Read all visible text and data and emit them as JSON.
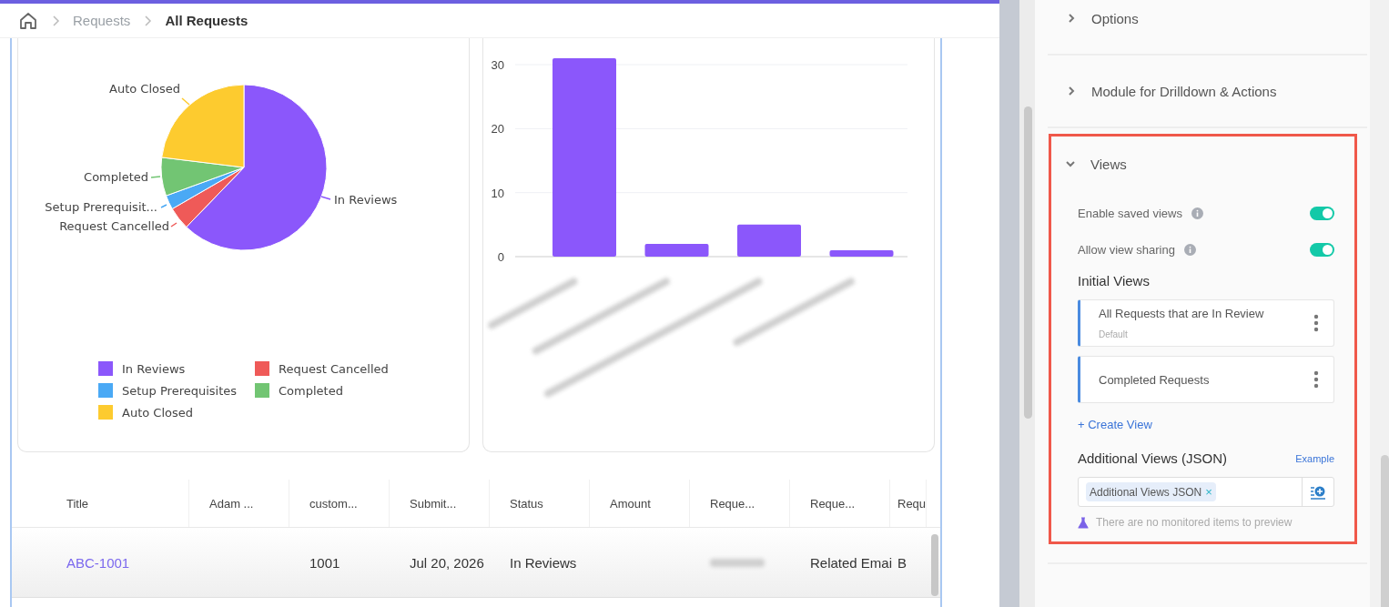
{
  "breadcrumb": [
    {
      "label": "Requests",
      "current": false
    },
    {
      "label": "All Requests",
      "current": true
    }
  ],
  "pie_chart": {
    "slice_labels": [
      "Auto Closed",
      "Completed",
      "In Reviews",
      "Setup Prerequisit...",
      "Request Cancelled"
    ],
    "legend": [
      {
        "label": "In Reviews",
        "color": "#8b57fb"
      },
      {
        "label": "Request Cancelled",
        "color": "#ef5a58"
      },
      {
        "label": "Setup Prerequisites",
        "color": "#4aa9f5"
      },
      {
        "label": "Completed",
        "color": "#72c573"
      },
      {
        "label": "Auto Closed",
        "color": "#fdcb2f"
      }
    ]
  },
  "bar_chart": {
    "chart_data": {
      "type": "bar",
      "values": [
        31,
        2,
        5,
        1
      ],
      "ylim": [
        0,
        31
      ],
      "yticks": [
        0,
        10,
        20,
        30
      ],
      "grid": true
    }
  },
  "table": {
    "columns": [
      "Title",
      "Adam ...",
      "custom...",
      "Submit...",
      "Status",
      "Amount",
      "Reque...",
      "Reque...",
      "Requ"
    ],
    "rows": [
      {
        "cells": [
          {
            "kind": "link",
            "text": "ABC-1001"
          },
          {
            "kind": "empty"
          },
          {
            "kind": "text",
            "text": "1001"
          },
          {
            "kind": "text",
            "text": "Jul 20, 2026"
          },
          {
            "kind": "text",
            "text": "In Reviews"
          },
          {
            "kind": "empty"
          },
          {
            "kind": "blurred"
          },
          {
            "kind": "text",
            "text": "Related Emai"
          },
          {
            "kind": "text",
            "text": "B"
          }
        ]
      }
    ]
  },
  "settings_panel": {
    "sections": [
      {
        "title": "Options",
        "expanded": false,
        "highlighted": false
      },
      {
        "title": "Module for Drilldown & Actions",
        "expanded": false,
        "highlighted": false
      },
      {
        "title": "Views",
        "expanded": true,
        "highlighted": true,
        "toggles": [
          {
            "label": "Enable saved views",
            "on": true
          },
          {
            "label": "Allow view sharing",
            "on": true
          }
        ],
        "initial_views_title": "Initial Views",
        "views": [
          {
            "name": "All Requests that are In Review",
            "subtitle": "Default"
          },
          {
            "name": "Completed Requests"
          }
        ],
        "create_link": "+ Create View",
        "additional_title": "Additional Views (JSON)",
        "example_link": "Example",
        "chips": [
          "Additional Views JSON"
        ],
        "chip_remove": "×",
        "hint": "There are no monitored items to preview"
      }
    ]
  }
}
